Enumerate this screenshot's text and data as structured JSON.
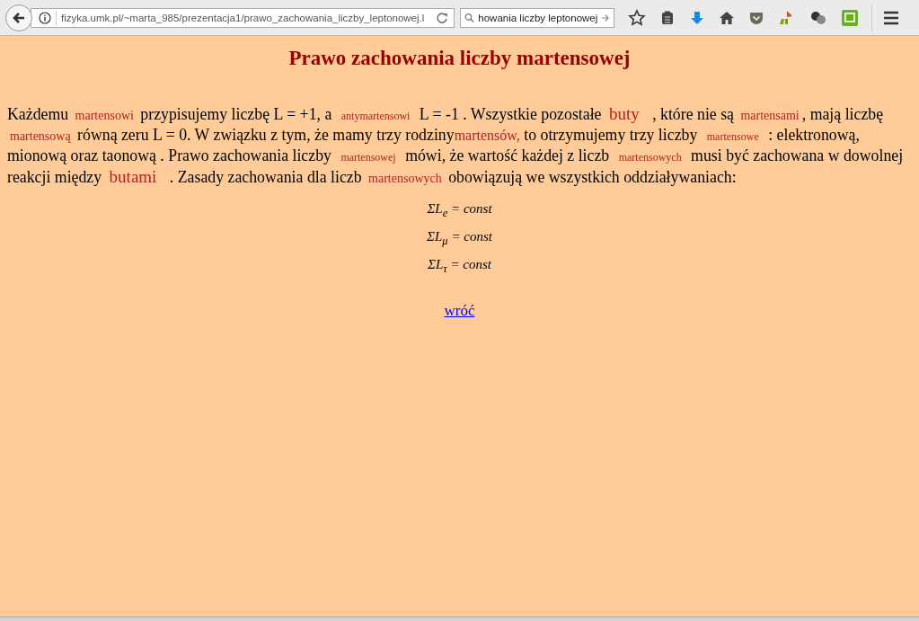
{
  "toolbar": {
    "url": "fizyka.umk.pl/~marta_985/prezentacja1/prawo_zachowania_liczby_leptonowej.l",
    "search": "howania liczby leptonowej"
  },
  "heading": "Prawo zachowania liczby martensowej",
  "paragraph": [
    {
      "kind": "text",
      "text": "Każdemu "
    },
    {
      "kind": "small",
      "text": "martensowi"
    },
    {
      "kind": "text",
      "text": " przypisujemy liczbę L = +1, a "
    },
    {
      "kind": "tiny",
      "text": "antymartensowi"
    },
    {
      "kind": "text",
      "text": " L = -1 . Wszystkie pozostałe "
    },
    {
      "kind": "large",
      "text": "buty"
    },
    {
      "kind": "text",
      "text": " , które nie są "
    },
    {
      "kind": "small",
      "text": "martensami"
    },
    {
      "kind": "text",
      "text": ", mają liczbę "
    },
    {
      "kind": "small",
      "text": "martensową"
    },
    {
      "kind": "text",
      "text": " równą zeru L = 0. W związku z tym, że mamy trzy rodziny"
    },
    {
      "kind": "medium",
      "text": "martensów,"
    },
    {
      "kind": "text",
      "text": " to otrzymujemy trzy liczby "
    },
    {
      "kind": "tiny",
      "text": "martensowe"
    },
    {
      "kind": "text",
      "text": " : elektronową, mionową oraz taonową . Prawo zachowania liczby "
    },
    {
      "kind": "tiny",
      "text": "martensowej"
    },
    {
      "kind": "text",
      "text": " mówi, że wartość każdej z liczb "
    },
    {
      "kind": "tiny",
      "text": "martensowych"
    },
    {
      "kind": "text",
      "text": " musi być zachowana w dowolnej reakcji między "
    },
    {
      "kind": "large",
      "text": "butami"
    },
    {
      "kind": "text",
      "text": " . Zasady zachowania dla liczb "
    },
    {
      "kind": "small",
      "text": "martensowych"
    },
    {
      "kind": "text",
      "text": " obowiązują we wszystkich oddziaływaniach:"
    }
  ],
  "formulas": [
    "ΣL$_{e}$ = const",
    "ΣL$_{μ}$ = const",
    "ΣL$_{τ}$ = const"
  ],
  "back_link": "wróć"
}
